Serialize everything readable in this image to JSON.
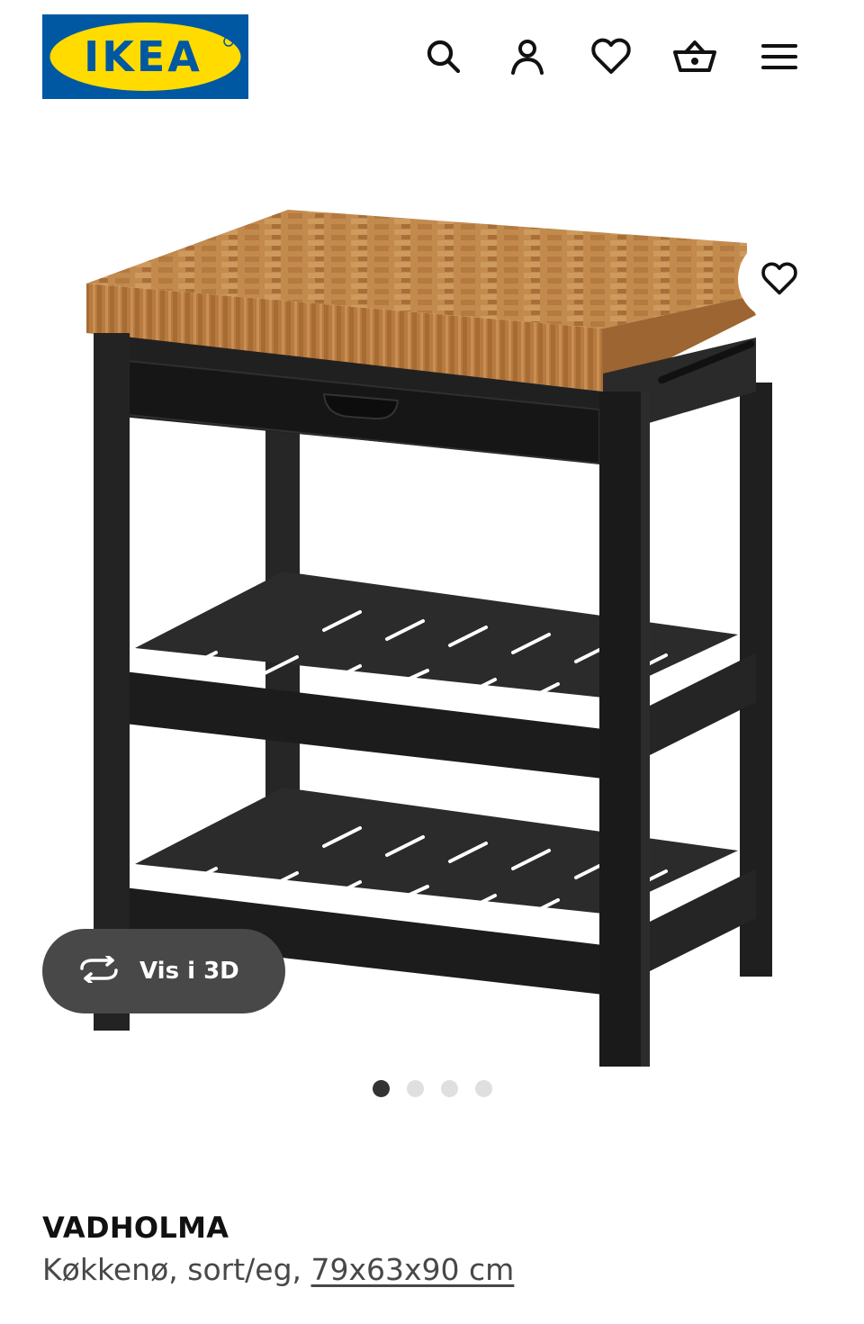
{
  "brand": {
    "logo_text": "IKEA",
    "colors": {
      "blue": "#0058a3",
      "yellow": "#ffdb00"
    }
  },
  "header": {
    "icons": [
      "search-icon",
      "account-icon",
      "heart-icon",
      "basket-icon",
      "menu-icon"
    ]
  },
  "gallery": {
    "view_3d_label": "Vis i 3D",
    "image_count": 4,
    "active_index": 0
  },
  "product": {
    "name": "VADHOLMA",
    "description": "Køkkenø, sort/eg,",
    "size": "79x63x90 cm"
  }
}
